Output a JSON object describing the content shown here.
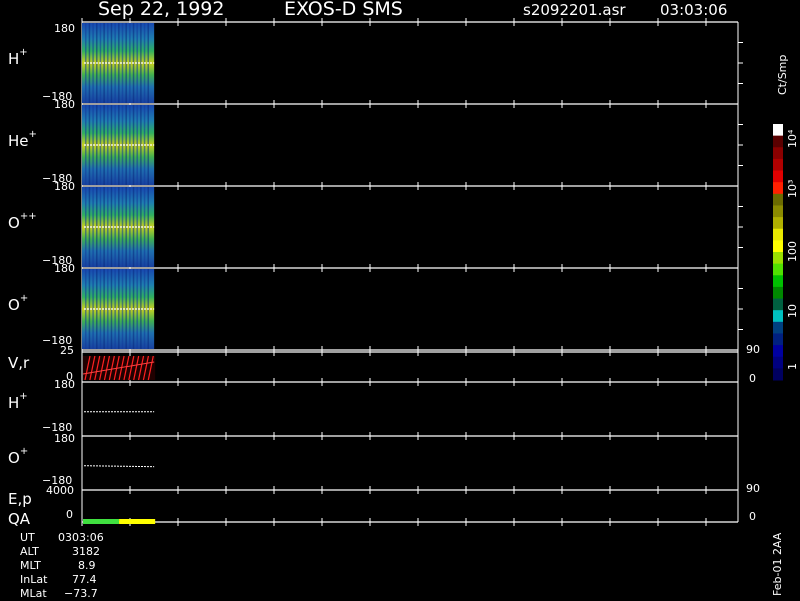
{
  "header": {
    "date": "Sep 22, 1992",
    "title": "EXOS-D SMS",
    "file": "s2092201.asr",
    "time": "03:03:06"
  },
  "panels": [
    {
      "id": "hplus-spec",
      "species": "H",
      "charge": "+",
      "ymax": "180",
      "ymin": "−180"
    },
    {
      "id": "heplus-spec",
      "species": "He",
      "charge": "+",
      "ymax": "180",
      "ymin": "−180"
    },
    {
      "id": "oplusplus-spec",
      "species": "O",
      "charge": "++",
      "ymax": "180",
      "ymin": "−180"
    },
    {
      "id": "oplus-spec",
      "species": "O",
      "charge": "+",
      "ymax": "180",
      "ymin": "−180"
    }
  ],
  "vr_panel": {
    "label": "V,r",
    "ymax": "25",
    "ymin": "0",
    "right_top": "90",
    "right_bottom": "0"
  },
  "line_panels": [
    {
      "id": "hplus-line",
      "species": "H",
      "charge": "+",
      "ymax": "180",
      "ymin": "−180"
    },
    {
      "id": "oplus-line",
      "species": "O",
      "charge": "+",
      "ymax": "180",
      "ymin": "−180"
    }
  ],
  "ep_panel": {
    "label1": "E,p",
    "label2": "QA",
    "ymax": "4000",
    "ymin": "0",
    "right_top": "90",
    "right_bottom": "0"
  },
  "colorbar": {
    "unit": "Ct/Smp",
    "labels": [
      "10⁴",
      "10³",
      "100",
      "10",
      "1"
    ],
    "colors": [
      "#ffffff",
      "#5a0000",
      "#8b0000",
      "#b00000",
      "#e00000",
      "#ff2000",
      "#6b6b00",
      "#8b8b00",
      "#b0b000",
      "#e8e800",
      "#ffff00",
      "#9be000",
      "#50e000",
      "#00c000",
      "#008800",
      "#006040",
      "#00c0c0",
      "#004080",
      "#002080",
      "#0000a0",
      "#000080",
      "#000060"
    ]
  },
  "info": {
    "rows": [
      {
        "label": "UT",
        "value": "0303:06"
      },
      {
        "label": "ALT",
        "value": "3182"
      },
      {
        "label": "MLT",
        "value": "8.9"
      },
      {
        "label": "InLat",
        "value": "77.4"
      },
      {
        "label": "MLat",
        "value": "−73.7"
      }
    ]
  },
  "footer": {
    "stamp": "Feb-01 2AA"
  },
  "chart_data": {
    "type": "heatmap",
    "title": "EXOS-D SMS",
    "x_extent_fraction": 0.11,
    "series": [
      {
        "name": "H+",
        "kind": "pitch-angle spectrogram",
        "yrange": [
          -180,
          180
        ]
      },
      {
        "name": "He+",
        "kind": "pitch-angle spectrogram",
        "yrange": [
          -180,
          180
        ]
      },
      {
        "name": "O++",
        "kind": "pitch-angle spectrogram",
        "yrange": [
          -180,
          180
        ]
      },
      {
        "name": "O+",
        "kind": "pitch-angle spectrogram",
        "yrange": [
          -180,
          180
        ]
      }
    ],
    "colorscale": {
      "unit": "Ct/Smp",
      "min": 1,
      "max": 10000,
      "scale": "log"
    },
    "vr": {
      "yrange": [
        0,
        25
      ],
      "right_range": [
        0,
        90
      ]
    },
    "line": {
      "yrange": [
        -180,
        180
      ]
    },
    "ep": {
      "yrange": [
        0,
        4000
      ],
      "right_range": [
        0,
        90
      ]
    },
    "qa_segments": [
      {
        "color": "#40e040",
        "fraction": 0.5
      },
      {
        "color": "#ffff00",
        "fraction": 0.5
      }
    ]
  }
}
